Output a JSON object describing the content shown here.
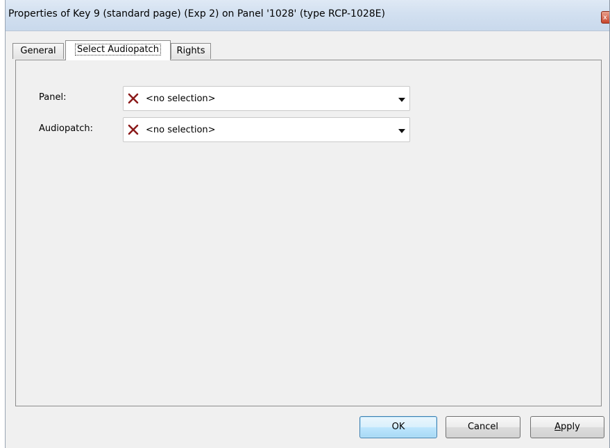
{
  "window": {
    "title": "Properties of Key 9 (standard page) (Exp 2) on Panel '1028' (type RCP-1028E)",
    "close_symbol": "x"
  },
  "tabs": [
    {
      "label": "General",
      "active": false
    },
    {
      "label": "Select Audiopatch",
      "active": true
    },
    {
      "label": "Rights",
      "active": false
    }
  ],
  "form": {
    "panel": {
      "label": "Panel:",
      "value": "<no selection>",
      "icon": "red-x-icon"
    },
    "audiopatch": {
      "label": "Audiopatch:",
      "value": "<no selection>",
      "icon": "red-x-icon"
    }
  },
  "buttons": {
    "ok": "OK",
    "cancel": "Cancel",
    "apply_first": "A",
    "apply_rest": "pply"
  },
  "colors": {
    "x_icon": "#8b1a1a",
    "default_button_border": "#3c7fb1"
  }
}
